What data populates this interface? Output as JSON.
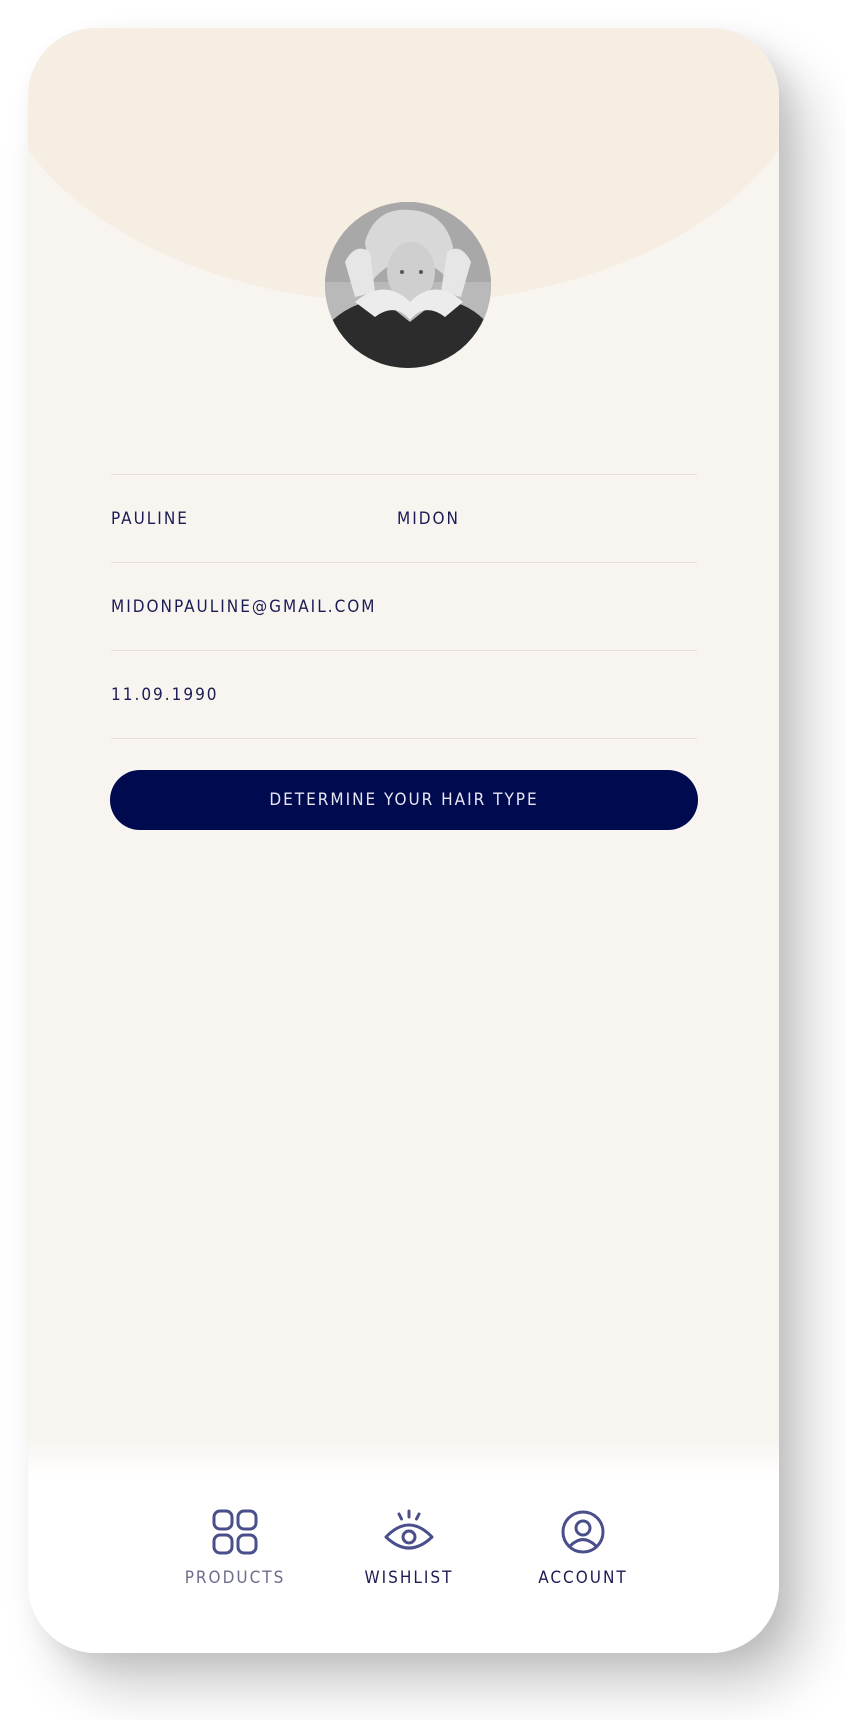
{
  "profile": {
    "first_name": "PAULINE",
    "last_name": "MIDON",
    "email": "MIDONPAULINE@GMAIL.COM",
    "birth_date": "11.09.1990"
  },
  "cta": {
    "label": "DETERMINE YOUR HAIR TYPE"
  },
  "tabs": [
    {
      "label": "PRODUCTS",
      "icon": "grid-icon",
      "active": false
    },
    {
      "label": "WISHLIST",
      "icon": "eye-icon",
      "active": false
    },
    {
      "label": "ACCOUNT",
      "icon": "user-circle-icon",
      "active": true
    }
  ],
  "colors": {
    "background": "#f8f4f0",
    "header": "#f6ede3",
    "primary": "#000a4f",
    "text": "#1c1c54",
    "divider": "#ecdcd6",
    "icon": "#4a4f8c"
  }
}
